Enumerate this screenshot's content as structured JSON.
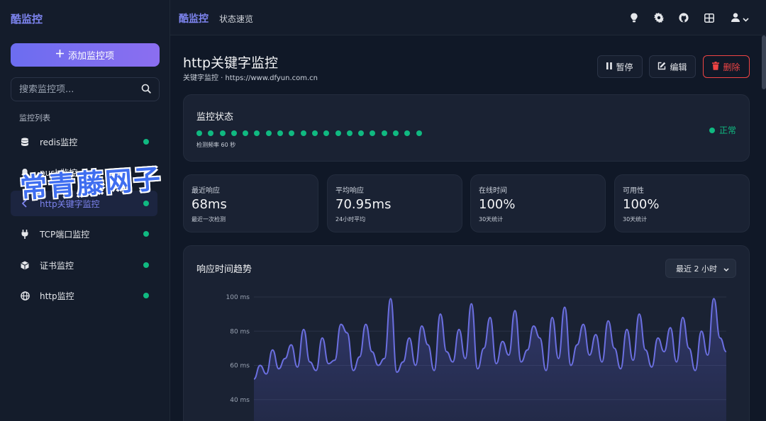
{
  "sidebar": {
    "logo": "酷监控",
    "add_button": "添加监控项",
    "search_placeholder": "搜索监控项...",
    "list_title": "监控列表",
    "items": [
      {
        "label": "redis监控",
        "icon": "database-icon",
        "status": "up"
      },
      {
        "label": "push监控",
        "icon": "bell-icon",
        "status": "up"
      },
      {
        "label": "http关键字监控",
        "icon": "chevron-left-icon",
        "status": "up",
        "active": true
      },
      {
        "label": "TCP端口监控",
        "icon": "plug-icon",
        "status": "up"
      },
      {
        "label": "证书监控",
        "icon": "cube-icon",
        "status": "up"
      },
      {
        "label": "http监控",
        "icon": "globe-icon",
        "status": "up"
      }
    ]
  },
  "header": {
    "brand": "酷监控",
    "crumb": "状态速览",
    "icons": [
      "lightbulb-icon",
      "gear-icon",
      "github-icon",
      "grid-icon",
      "user-icon"
    ]
  },
  "monitor": {
    "title": "http关键字监控",
    "subtitle": "关键字监控 · https://www.dfyun.com.cn",
    "actions": {
      "pause": "暂停",
      "edit": "编辑",
      "delete": "删除"
    }
  },
  "status": {
    "title": "监控状态",
    "beats": 20,
    "interval": "检测频率 60 秒",
    "state": "正常"
  },
  "stats": [
    {
      "label": "最近响应",
      "value": "68ms",
      "note": "最近一次检测"
    },
    {
      "label": "平均响应",
      "value": "70.95ms",
      "note": "24小时平均"
    },
    {
      "label": "在线时间",
      "value": "100%",
      "note": "30天统计"
    },
    {
      "label": "可用性",
      "value": "100%",
      "note": "30天统计"
    }
  ],
  "chart": {
    "title": "响应时间趋势",
    "range": "最近 2 小时"
  },
  "watermark": "常青藤网子",
  "colors": {
    "accent": "#7d84ef",
    "success": "#10b981",
    "danger": "#ef4444",
    "line": "#6b6fe0"
  },
  "chart_data": {
    "type": "area",
    "title": "响应时间趋势",
    "xlabel": "",
    "ylabel": "",
    "y_ticks": [
      "100 ms",
      "80 ms",
      "60 ms",
      "40 ms"
    ],
    "ylim": [
      30,
      100
    ],
    "grid": true,
    "series": [
      {
        "values": [
          52,
          60,
          55,
          69,
          58,
          64,
          72,
          59,
          81,
          62,
          57,
          76,
          61,
          63,
          84,
          79,
          57,
          65,
          84,
          68,
          60,
          64,
          99,
          56,
          62,
          76,
          60,
          83,
          72,
          57,
          90,
          68,
          62,
          81,
          64,
          96,
          58,
          70,
          88,
          61,
          74,
          66,
          92,
          62,
          69,
          83,
          76,
          57,
          88,
          64,
          94,
          60,
          72,
          84,
          66,
          78,
          62,
          86,
          70,
          58,
          81,
          63,
          90,
          69,
          59,
          76,
          68,
          82,
          62,
          88,
          70,
          57,
          80,
          66,
          99,
          76,
          68
        ]
      }
    ]
  }
}
